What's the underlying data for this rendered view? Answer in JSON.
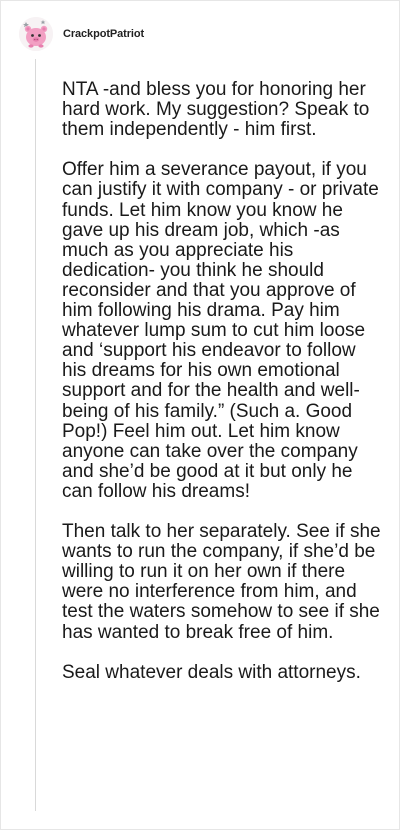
{
  "post": {
    "author": "CrackpotPatriot",
    "avatar_icon": "pink-cartoon-avatar-icon",
    "paragraphs": [
      "NTA -and bless you for honoring her hard work. My suggestion? Speak to them independently - him first.",
      "Offer him a severance payout, if you can justify it with company - or private funds. Let him know you know he gave up his dream job, which -as much as you appreciate his dedication- you think he should reconsider and that you approve of him following his drama. Pay him whatever lump sum to cut him loose and ‘support his endeavor to follow his dreams for his own emotional support and for the health and well-being of his family.” (Such a. Good Pop!) Feel him out. Let him know anyone can take over the company and she’d be good at it but only he can follow his dreams!",
      "Then talk to her separately. See if she wants to run the company, if she’d be willing to run it on her own if there were no interference from him, and test the waters somehow to see if she has wanted to break free of him.",
      "Seal whatever deals with attorneys."
    ]
  },
  "colors": {
    "avatar_pink": "#f29fc3",
    "text": "#1a1a1a",
    "thread_line": "#d9d9d9"
  }
}
